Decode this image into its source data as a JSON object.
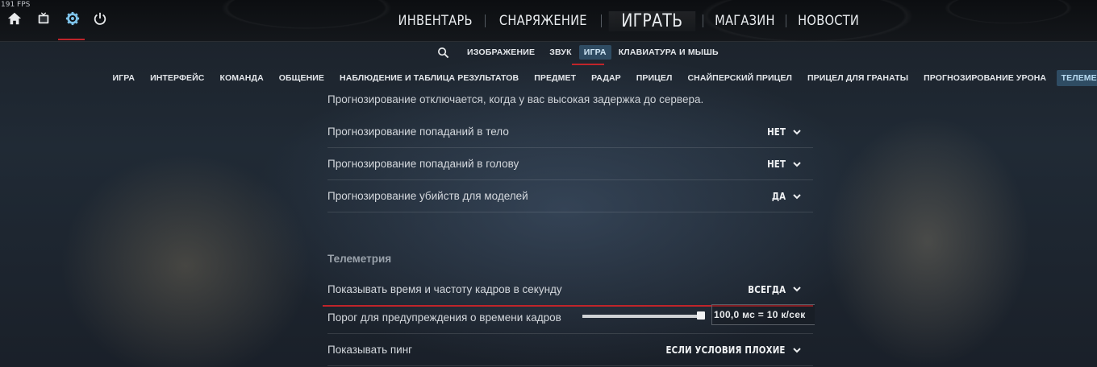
{
  "fps_counter": "191 FPS",
  "top_icons": [
    "home-icon",
    "tv-icon",
    "gear-icon",
    "power-icon"
  ],
  "main_nav": {
    "inventory": "ИНВЕНТАРЬ",
    "loadout": "СНАРЯЖЕНИЕ",
    "play": "ИГРАТЬ",
    "store": "МАГАЗИН",
    "news": "НОВОСТИ"
  },
  "settings_nav": {
    "video": "ИЗОБРАЖЕНИЕ",
    "audio": "ЗВУК",
    "game": "ИГРА",
    "keyboard_mouse": "КЛАВИАТУРА И МЫШЬ"
  },
  "game_tabs": [
    "ИГРА",
    "ИНТЕРФЕЙС",
    "КОМАНДА",
    "ОБЩЕНИЕ",
    "НАБЛЮДЕНИЕ И ТАБЛИЦА РЕЗУЛЬТАТОВ",
    "ПРЕДМЕТ",
    "РАДАР",
    "ПРИЦЕЛ",
    "СНАЙПЕРСКИЙ ПРИЦЕЛ",
    "ПРИЦЕЛ ДЛЯ ГРАНАТЫ",
    "ПРОГНОЗИРОВАНИЕ УРОНА",
    "ТЕЛЕМЕТРИЯ"
  ],
  "active_game_tab": "ТЕЛЕМЕТРИЯ",
  "settings": {
    "note": "Прогнозирование отключается, когда у вас высокая задержка до сервера.",
    "rows": [
      {
        "label": "Прогнозирование попаданий в тело",
        "value": "НЕТ"
      },
      {
        "label": "Прогнозирование попаданий в голову",
        "value": "НЕТ"
      },
      {
        "label": "Прогнозирование убийств для моделей",
        "value": "ДА"
      }
    ],
    "telemetry_title": "Телеметрия",
    "show_frametime": {
      "label": "Показывать время и частоту кадров в секунду",
      "value": "ВСЕГДА"
    },
    "frametime_threshold": {
      "label": "Порог для предупреждения о времени кадров",
      "value": "100,0 мс = 10 к/сек",
      "slider_fraction": 1.0
    },
    "show_ping": {
      "label": "Показывать пинг",
      "value": "ЕСЛИ УСЛОВИЯ ПЛОХИЕ"
    }
  }
}
